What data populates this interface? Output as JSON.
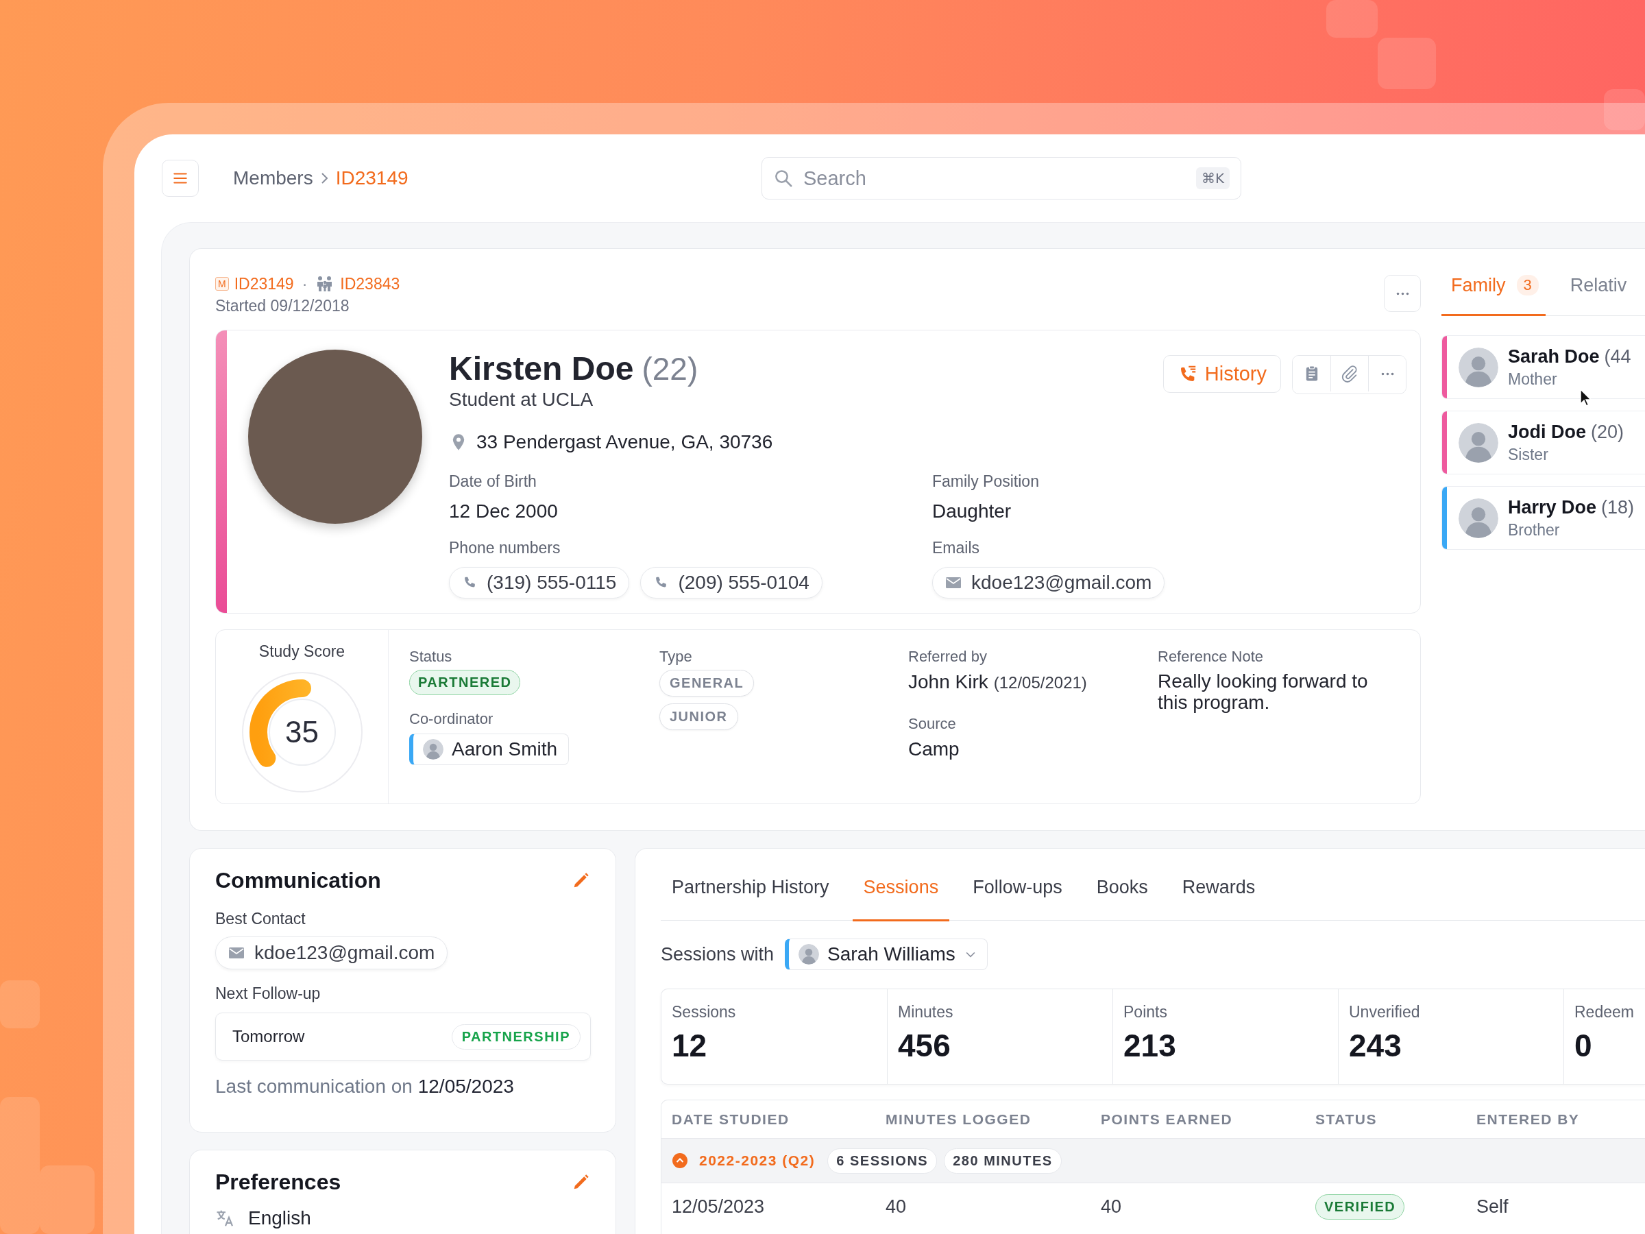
{
  "topbar": {
    "breadcrumb": [
      {
        "label": "Members",
        "selected": false
      },
      {
        "label": "ID23149",
        "selected": true
      }
    ],
    "search": {
      "placeholder": "Search",
      "shortcut": "⌘K"
    }
  },
  "member": {
    "ids": [
      {
        "kind": "member",
        "badge": "M",
        "label": "ID23149"
      },
      {
        "kind": "family",
        "label": "ID23843"
      }
    ],
    "id_separator": "·",
    "started": "Started 09/12/2018",
    "name": "Kirsten Doe",
    "age": "(22)",
    "subtitle": "Student at UCLA",
    "address": "33 Pendergast Avenue, GA, 30736",
    "fields": [
      {
        "label": "Date of Birth",
        "value": "12 Dec 2000"
      },
      {
        "label": "Family Position",
        "value": "Daughter"
      }
    ],
    "contacts": [
      {
        "label": "Phone numbers",
        "kind": "phone",
        "items": [
          "(319) 555-0115",
          "(209) 555-0104"
        ]
      },
      {
        "label": "Emails",
        "kind": "email",
        "items": [
          "kdoe123@gmail.com"
        ]
      }
    ],
    "history_button": "History"
  },
  "summary": {
    "score": {
      "label": "Study Score",
      "value": "35",
      "level": 0.35
    },
    "status": {
      "label": "Status",
      "value": "PARTNERED"
    },
    "coordinator": {
      "label": "Co-ordinator",
      "name": "Aaron Smith"
    },
    "type": {
      "label": "Type",
      "tags": [
        "GENERAL",
        "JUNIOR"
      ]
    },
    "referred_by": {
      "label": "Referred by",
      "name": "John Kirk",
      "date": "(12/05/2021)"
    },
    "source": {
      "label": "Source",
      "value": "Camp"
    },
    "reference_note": {
      "label": "Reference Note",
      "value": "Really looking forward to this program."
    }
  },
  "family": {
    "tabs": [
      {
        "label": "Family",
        "count": "3",
        "selected": true
      },
      {
        "label": "Relativ",
        "selected": false
      }
    ],
    "members": [
      {
        "name": "Sarah Doe",
        "age": "(44",
        "relation": "Mother",
        "color": "#ee5a9e"
      },
      {
        "name": "Jodi Doe",
        "age": "(20)",
        "relation": "Sister",
        "color": "#ee5a9e"
      },
      {
        "name": "Harry Doe",
        "age": "(18)",
        "relation": "Brother",
        "color": "#3aa8f5"
      }
    ]
  },
  "communication": {
    "title": "Communication",
    "best_contact_label": "Best Contact",
    "best_contact": "kdoe123@gmail.com",
    "next_follow_up_label": "Next Follow-up",
    "next_follow_up": {
      "value": "Tomorrow",
      "tag": "PARTNERSHIP"
    },
    "last": "Last communication on **12/05/2023**"
  },
  "preferences": {
    "title": "Preferences",
    "items": [
      {
        "kind": "language",
        "text": "English"
      }
    ]
  },
  "sessions": {
    "tabs": [
      {
        "label": "Partnership History",
        "selected": false
      },
      {
        "label": "Sessions",
        "selected": true
      },
      {
        "label": "Follow-ups",
        "selected": false
      },
      {
        "label": "Books",
        "selected": false
      },
      {
        "label": "Rewards",
        "selected": false
      }
    ],
    "filter_label": "Sessions with",
    "partner": "Sarah Williams",
    "stats": [
      {
        "label": "Sessions",
        "value": "12"
      },
      {
        "label": "Minutes",
        "value": "456"
      },
      {
        "label": "Points",
        "value": "213"
      },
      {
        "label": "Unverified",
        "value": "243"
      },
      {
        "label": "Redeem",
        "value": "0"
      }
    ],
    "columns": [
      "DATE STUDIED",
      "MINUTES LOGGED",
      "POINTS EARNED",
      "STATUS",
      "ENTERED BY"
    ],
    "groups": [
      {
        "label": "2022-2023 (Q2)",
        "expanded": true,
        "badges": [
          "6 SESSIONS",
          "280 MINUTES"
        ],
        "rows": [
          {
            "date": "12/05/2023",
            "minutes": "40",
            "points": "40",
            "status": "VERIFIED",
            "entered_by": "Self"
          }
        ]
      }
    ]
  }
}
